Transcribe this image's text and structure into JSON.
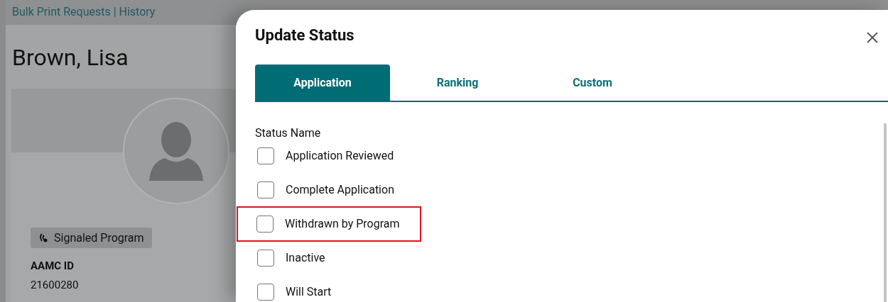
{
  "page": {
    "header_link": "Bulk Print Requests | History",
    "name": "Brown, Lisa",
    "badge": "Signaled Program",
    "id_label": "AAMC ID",
    "id_value": "21600280"
  },
  "dialog": {
    "title": "Update Status",
    "tabs": [
      {
        "label": "Application",
        "selected": true
      },
      {
        "label": "Ranking",
        "selected": false
      },
      {
        "label": "Custom",
        "selected": false
      }
    ],
    "field_label": "Status Name",
    "statuses": [
      {
        "label": "Application Reviewed",
        "checked": false,
        "highlighted": false
      },
      {
        "label": "Complete Application",
        "checked": false,
        "highlighted": false
      },
      {
        "label": "Withdrawn by Program",
        "checked": false,
        "highlighted": true
      },
      {
        "label": "Inactive",
        "checked": false,
        "highlighted": false
      },
      {
        "label": "Will Start",
        "checked": false,
        "highlighted": false
      }
    ]
  }
}
